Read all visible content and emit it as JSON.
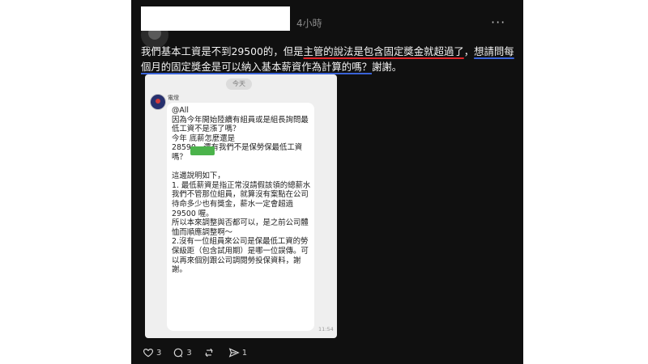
{
  "post": {
    "time": "4小時",
    "more_icon": "more-horizontal-icon",
    "text_parts": [
      "我們基本工資是不到29500的，但是",
      "主管的說法是包含固定獎金就超過了",
      "，",
      "想請問每個月的固定獎金是可以納入基本薪資作為計算的嗎？",
      "謝謝。"
    ],
    "underline_colors": {
      "red": "#e0262a",
      "blue": "#3a63d8"
    }
  },
  "screenshot": {
    "day_label": "今天",
    "sender_name": "電燈",
    "message": "@All\n因為今年開始陸續有組員或是組長詢問最低工資不是漲了嗎？\n今年          底薪怎麼還是\n28590，還有我們不是保勞保最低工資嗎？\n\n這邊說明如下，\n1. 最低薪資是指正常沒請假該領的總薪水\n我們不管那位組員，就算沒有案點在公司待命多少也有獎金，薪水一定會超過 29500 喔。\n所以本來調整與否都可以，是之前公司體恤而順應調整啊～\n2.沒有一位組員來公司是保最低工資的勞保級距（包含試用期）是哪一位誤傳。可以再來個別跟公司調閱勞投保資料，謝謝。",
    "time": "11:54"
  },
  "actions": {
    "like": {
      "icon": "heart-icon",
      "count": "3"
    },
    "comment": {
      "icon": "comment-icon",
      "count": "3"
    },
    "repost": {
      "icon": "repost-icon",
      "count": ""
    },
    "share": {
      "icon": "share-icon",
      "count": "1"
    }
  }
}
